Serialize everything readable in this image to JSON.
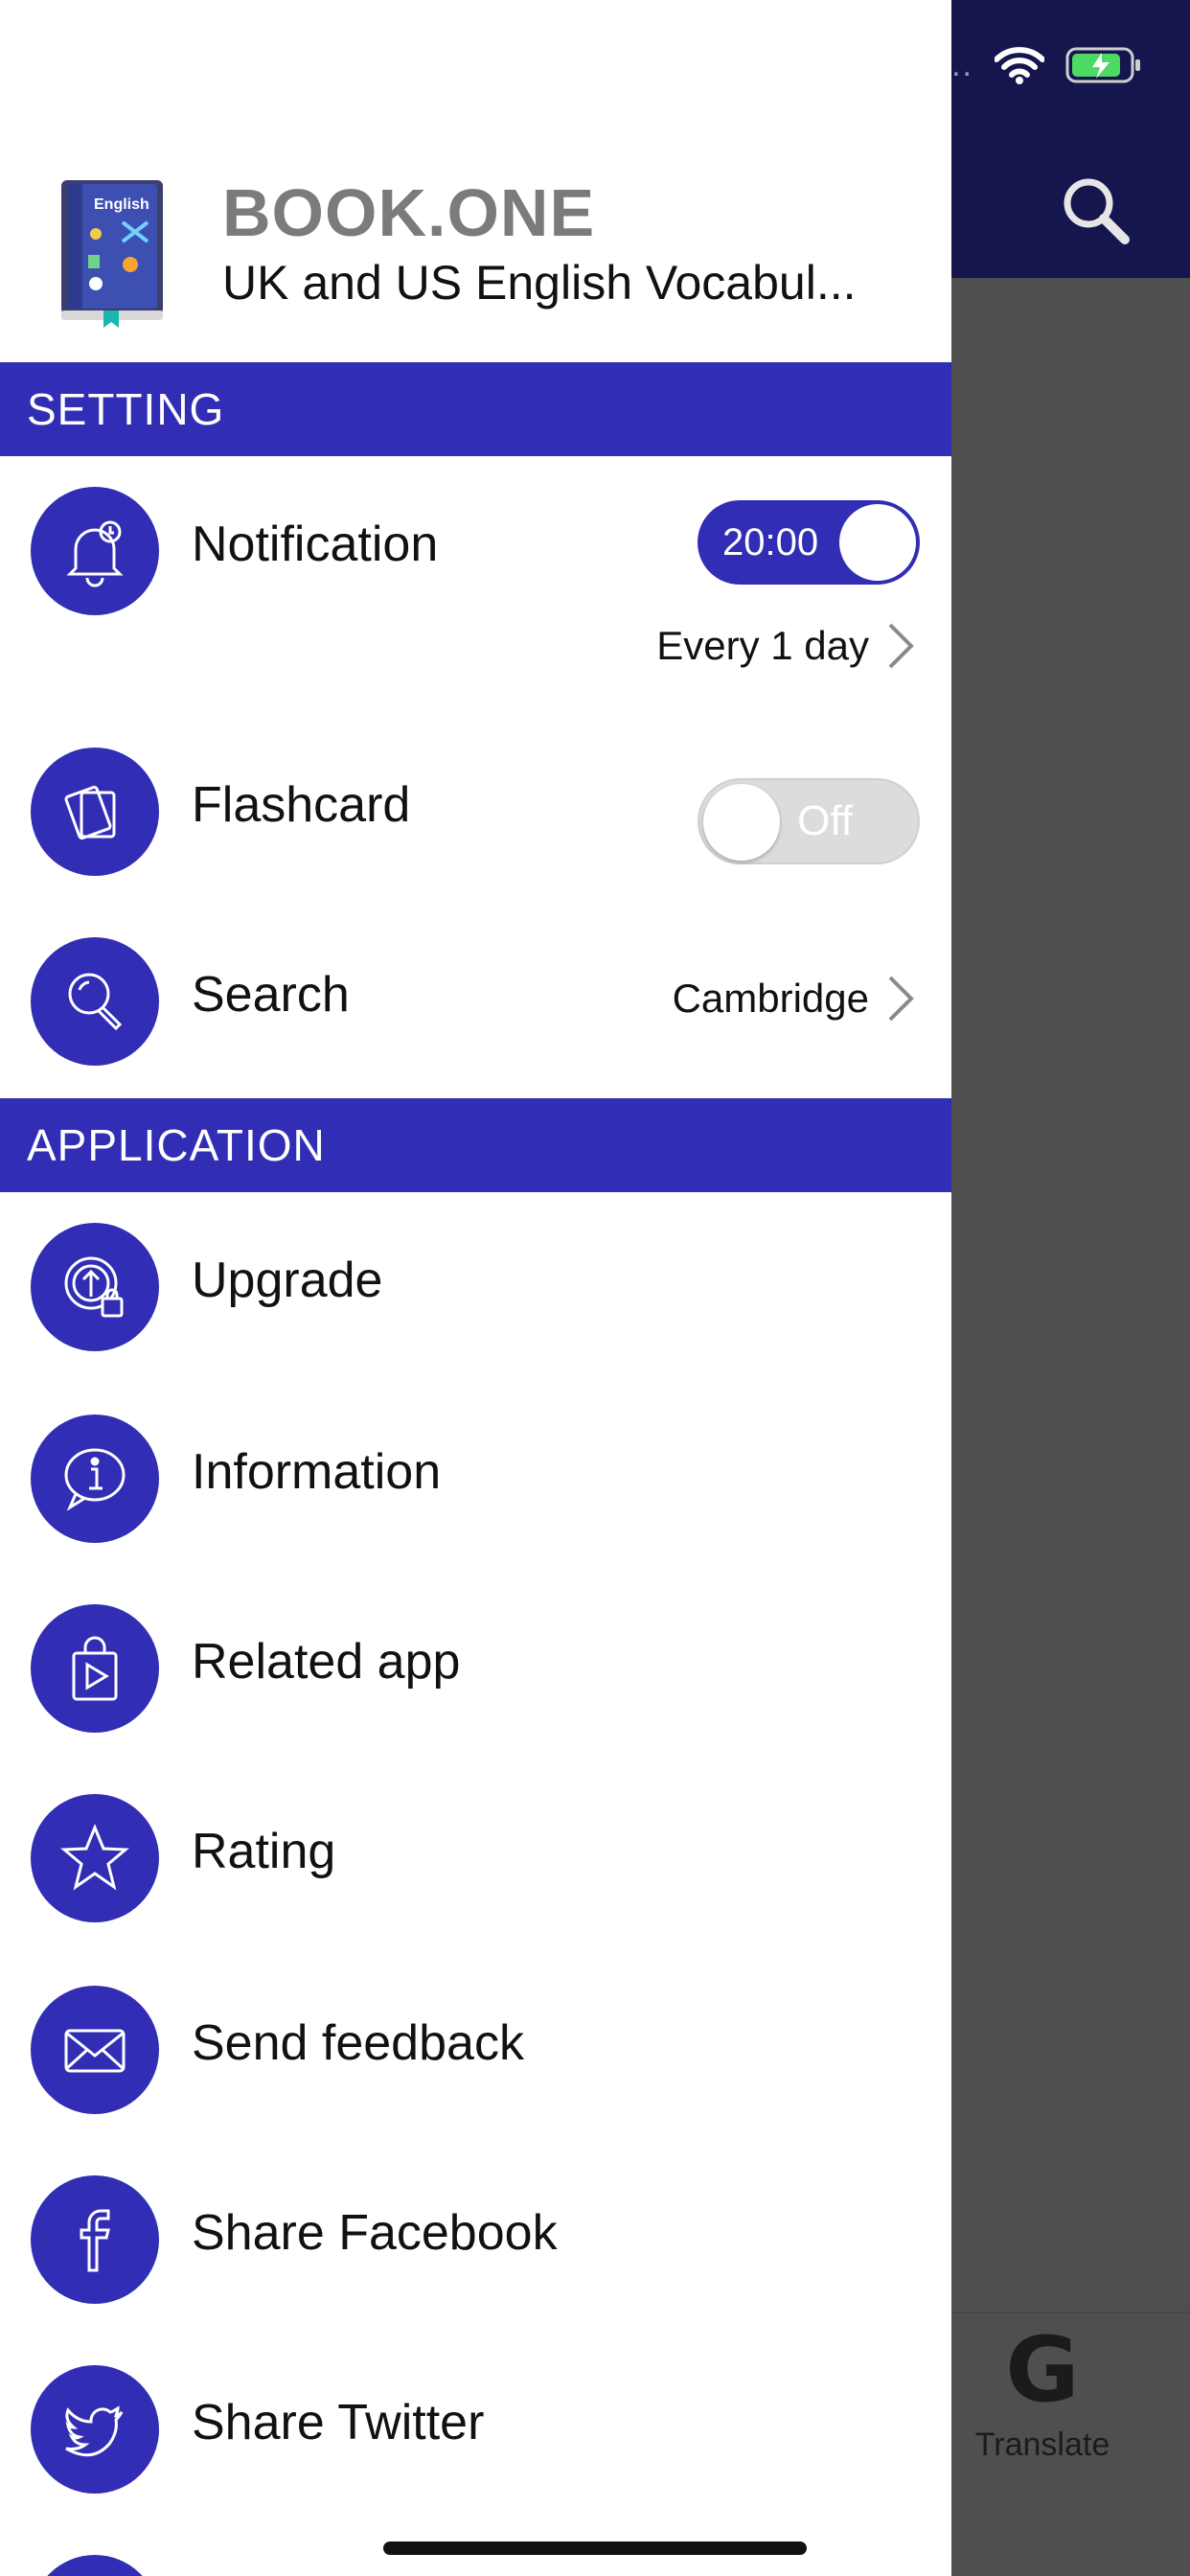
{
  "header": {
    "title": "BOOK.ONE",
    "subtitle": "UK and US English Vocabul..."
  },
  "sections": {
    "setting": "SETTING",
    "application": "APPLICATION"
  },
  "settings": {
    "notification": {
      "label": "Notification",
      "time": "20:00",
      "enabled": true,
      "frequency": "Every 1 day"
    },
    "flashcard": {
      "label": "Flashcard",
      "toggle_text": "Off",
      "enabled": false
    },
    "search": {
      "label": "Search",
      "value": "Cambridge"
    }
  },
  "application": {
    "upgrade": "Upgrade",
    "information": "Information",
    "related_app": "Related app",
    "rating": "Rating",
    "send_feedback": "Send feedback",
    "share_facebook": "Share Facebook",
    "share_twitter": "Share Twitter"
  },
  "background": {
    "translate_tab": "Translate",
    "translate_icon": "G"
  },
  "colors": {
    "accent": "#312eb5",
    "topbar": "#16164e",
    "overlay": "#4f4f4f"
  }
}
